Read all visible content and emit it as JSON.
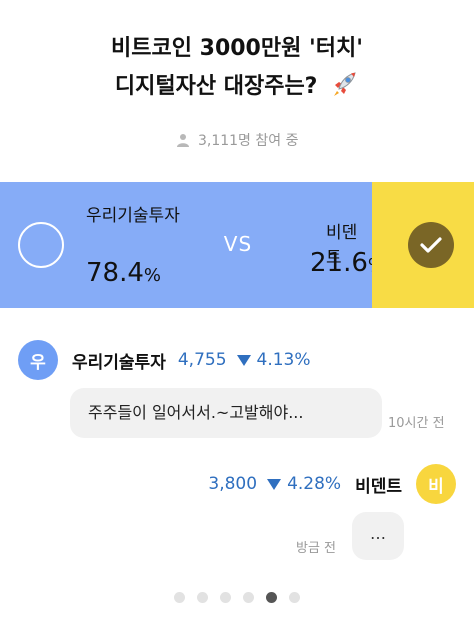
{
  "title": {
    "line1": "비트코인 3000만원 '터치'",
    "line2": "디지털자산 대장주는?"
  },
  "participants": "3,111명 참여 중",
  "vote": {
    "left": {
      "name": "우리기술투자",
      "percent": "78.4",
      "unit": "%"
    },
    "vs": "VS",
    "right": {
      "name": "비덴트",
      "percent": "21.6",
      "unit": "%",
      "selected": true
    }
  },
  "stocks": [
    {
      "avatar": "우",
      "name": "우리기술투자",
      "price": "4,755",
      "change": "4.13%",
      "direction": "down",
      "comment": "주주들이 일어서서.~고발해야...",
      "time": "10시간 전"
    },
    {
      "avatar": "비",
      "name": "비덴트",
      "price": "3,800",
      "change": "4.28%",
      "direction": "down",
      "comment": "…",
      "time": "방금 전"
    }
  ],
  "pagination": {
    "total": 6,
    "active": 5
  },
  "colors": {
    "left_option_bg": "#86acf7",
    "right_option_bg": "#f8dc45",
    "down_color": "#2f6fbf",
    "check_bg": "#7a6626"
  },
  "icons": [
    "rocket-icon",
    "person-icon",
    "check-icon",
    "down-triangle-icon"
  ]
}
